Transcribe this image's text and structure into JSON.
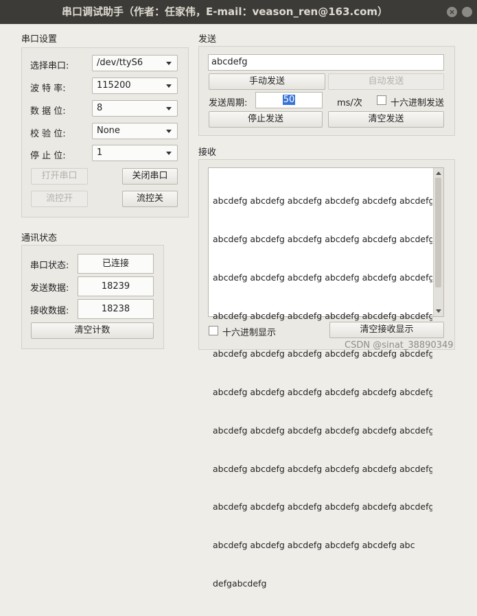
{
  "window": {
    "title": "串口调试助手（作者：任家伟，E-mail：veason_ren@163.com）"
  },
  "serial_settings": {
    "title": "串口设置",
    "port": {
      "label": "选择串口:",
      "value": "/dev/ttyS6"
    },
    "baud": {
      "label": "波 特 率:",
      "value": "115200"
    },
    "databits": {
      "label": "数 据 位:",
      "value": "8"
    },
    "parity": {
      "label": "校 验 位:",
      "value": "None"
    },
    "stopbits": {
      "label": "停 止 位:",
      "value": "1"
    },
    "open_button": "打开串口",
    "close_button": "关闭串口",
    "flow_on_button": "流控开",
    "flow_off_button": "流控关"
  },
  "status": {
    "title": "通讯状态",
    "port_state": {
      "label": "串口状态:",
      "value": "已连接"
    },
    "sent": {
      "label": "发送数据:",
      "value": "18239"
    },
    "received": {
      "label": "接收数据:",
      "value": "18238"
    },
    "clear_count_button": "清空计数"
  },
  "send": {
    "title": "发送",
    "input_value": "abcdefg",
    "manual_button": "手动发送",
    "auto_button": "自动发送",
    "period_label": "发送周期:",
    "period_value": "50",
    "period_unit": "ms/次",
    "hex_send_label": "十六进制发送",
    "stop_button": "停止发送",
    "clear_button": "清空发送"
  },
  "receive": {
    "title": "接收",
    "lines": [
      "abcdefg abcdefg abcdefg abcdefg abcdefg abcdefg",
      "abcdefg abcdefg abcdefg abcdefg abcdefg abcdefg",
      "abcdefg abcdefg abcdefg abcdefg abcdefg abcdefg",
      "abcdefg abcdefg abcdefg abcdefg abcdefg abcdefg",
      "abcdefg abcdefg abcdefg abcdefg abcdefg abcdefg",
      "abcdefg abcdefg abcdefg abcdefg abcdefg abcdefg",
      "abcdefg abcdefg abcdefg abcdefg abcdefg abcdefg",
      "abcdefg abcdefg abcdefg abcdefg abcdefg abcdefg",
      "abcdefg abcdefg abcdefg abcdefg abcdefg abcdefg",
      "abcdefg abcdefg abcdefg abcdefg abcdefg abc",
      "defgabcdefg"
    ],
    "hex_display_label": "十六进制显示",
    "clear_button": "清空接收显示"
  },
  "watermark": "CSDN @sinat_38890349"
}
